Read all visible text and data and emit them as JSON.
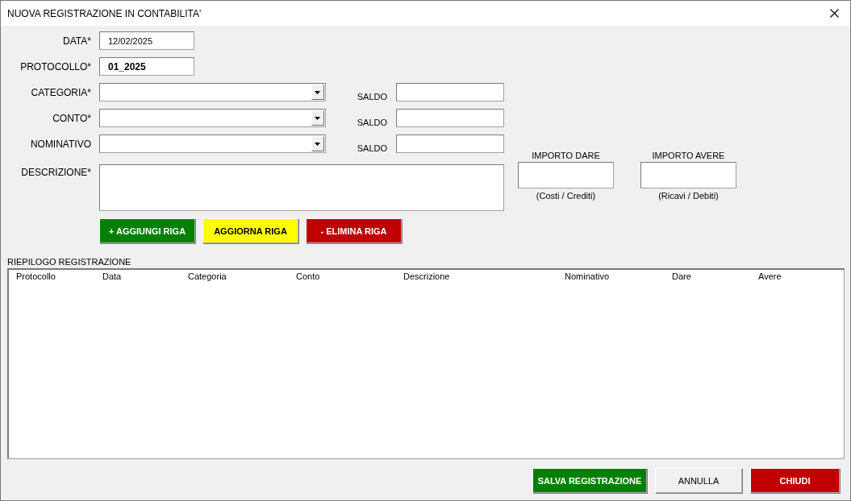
{
  "window": {
    "title": "NUOVA REGISTRAZIONE IN CONTABILITA'"
  },
  "fields": [
    {
      "kind": "text",
      "label": "DATA*",
      "value": "12/02/2025",
      "bold": false
    },
    {
      "kind": "text",
      "label": "PROTOCOLLO*",
      "value": "01_2025",
      "bold": true
    },
    {
      "kind": "combo",
      "label": "CATEGORIA*",
      "saldo_label": "SALDO"
    },
    {
      "kind": "combo",
      "label": "CONTO*",
      "saldo_label": "SALDO"
    },
    {
      "kind": "combo",
      "label": "NOMINATIVO",
      "saldo_label": "SALDO"
    },
    {
      "kind": "memo",
      "label": "DESCRIZIONE*"
    }
  ],
  "amounts": [
    {
      "label": "IMPORTO DARE",
      "note": "(Costi / Crediti)"
    },
    {
      "label": "IMPORTO AVERE",
      "note": "(Ricavi / Debiti)"
    }
  ],
  "row_buttons": [
    {
      "label": "+ AGGIUNGI RIGA",
      "kind": "green"
    },
    {
      "label": "AGGIORNA RIGA",
      "kind": "yellow"
    },
    {
      "label": "- ELIMINA RIGA",
      "kind": "red"
    }
  ],
  "summary": {
    "title": "RIEPILOGO REGISTRAZIONE",
    "columns": [
      "Protocollo",
      "Data",
      "Categoria",
      "Conto",
      "Descrizione",
      "Nominativo",
      "Dare",
      "Avere"
    ]
  },
  "footer_buttons": [
    {
      "label": "SALVA REGISTRAZIONE",
      "kind": "green"
    },
    {
      "label": "ANNULLA",
      "kind": "plain"
    },
    {
      "label": "CHIUDI",
      "kind": "red"
    }
  ]
}
